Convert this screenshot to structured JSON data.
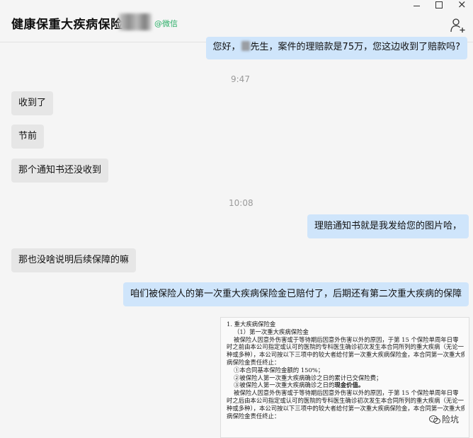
{
  "window": {
    "title": "健康保重大疾病保险",
    "title_tag": "@微信",
    "controls": {
      "close": "×"
    }
  },
  "messages": [
    {
      "side": "self",
      "text_before": "您好，",
      "text_after": "先生，案件的理赔款是75万，您这边收到了赔款吗?"
    },
    {
      "side": "time",
      "text": "9:47"
    },
    {
      "side": "other",
      "text": "收到了"
    },
    {
      "side": "other",
      "text": "节前"
    },
    {
      "side": "other",
      "text": "那个通知书还没收到"
    },
    {
      "side": "time",
      "text": "10:08"
    },
    {
      "side": "self",
      "text": "理赔通知书就是我发给您的图片哈，"
    },
    {
      "side": "other",
      "text": "那也没啥说明后续保障的嘛"
    },
    {
      "side": "self",
      "text": "咱们被保险人的第一次重大疾病保险金已赔付了，后期还有第二次重大疾病的保障"
    }
  ],
  "document_image": {
    "lines": [
      "1. 重大疾病保险金",
      "（1）第一次重大疾病保险金",
      "被保险人因意外伤害或于等待期后因意外伤害以外的原因，于第 15 个保险单周年日零",
      "时之前由本公司指定或认可的医院的专科医生确诊初次发生本合同所列的重大疾病（无论一",
      "种或多种），本公司按以下三项中的较大者给付第一次重大疾病保险金，本合同第一次重大疾",
      "病保险金责任终止：",
      "①本合同基本保险金额的 150%；",
      "②被保险人第一次重大疾病确诊之日的累计已交保险费；",
      "③被保险人第一次重大疾病确诊之日的",
      "现金价值。",
      "被保险人因意外伤害或于等待期后因意外伤害以外的原因，于第 15 个保险单周年日零",
      "时之后由本公司指定或认可的医院的专科医生确诊初次发生本合同所列的重大疾病（无论一",
      "种或多种），本公司按以下三项中的较大者给付第一次重大疾病保险金，本合同第一次重大疾",
      "病保险金责任终止："
    ],
    "watermark": "险坑"
  }
}
